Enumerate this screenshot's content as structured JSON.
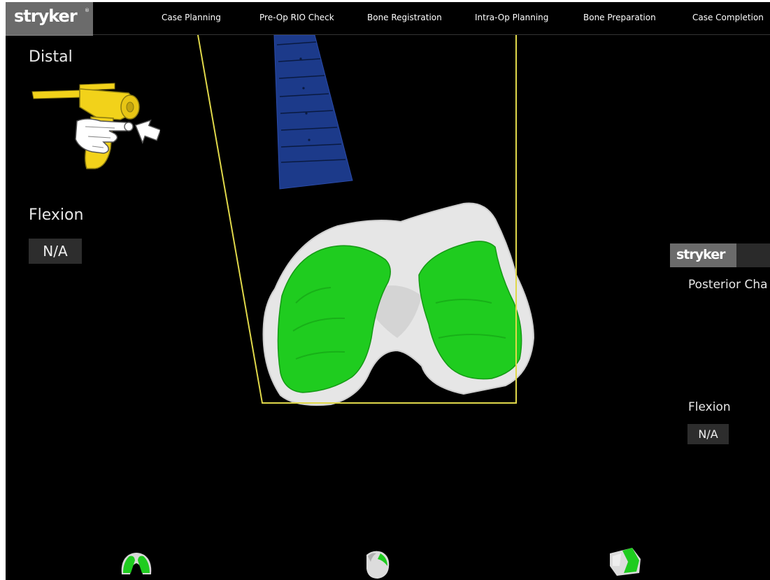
{
  "brand": {
    "logo": "stryker",
    "registered_mark": "®"
  },
  "nav": {
    "items": [
      {
        "label": "Case Planning"
      },
      {
        "label": "Pre-Op RIO Check"
      },
      {
        "label": "Bone Registration"
      },
      {
        "label": "Intra-Op Planning"
      },
      {
        "label": "Bone Preparation"
      },
      {
        "label": "Case Completion"
      }
    ]
  },
  "left_panel": {
    "distal_label": "Distal",
    "flexion_label": "Flexion",
    "flexion_value": "N/A"
  },
  "right_panel": {
    "logo": "stryker",
    "registered_mark": "®",
    "title": "Posterior Cha",
    "flexion_label": "Flexion",
    "flexion_value": "N/A"
  },
  "colors": {
    "background": "#000000",
    "logo_bg": "#6b6b6b",
    "cut_region": "#1fcc1f",
    "bone": "#e6e6e6",
    "boundary": "#e0d84a",
    "probe": "#1c3a8a",
    "tool": "#f2d21a"
  },
  "icons": {
    "tool": "probe-tool-icon",
    "view_buttons": [
      "femur-front-view-icon",
      "femur-distal-view-icon",
      "femur-side-view-icon"
    ]
  }
}
